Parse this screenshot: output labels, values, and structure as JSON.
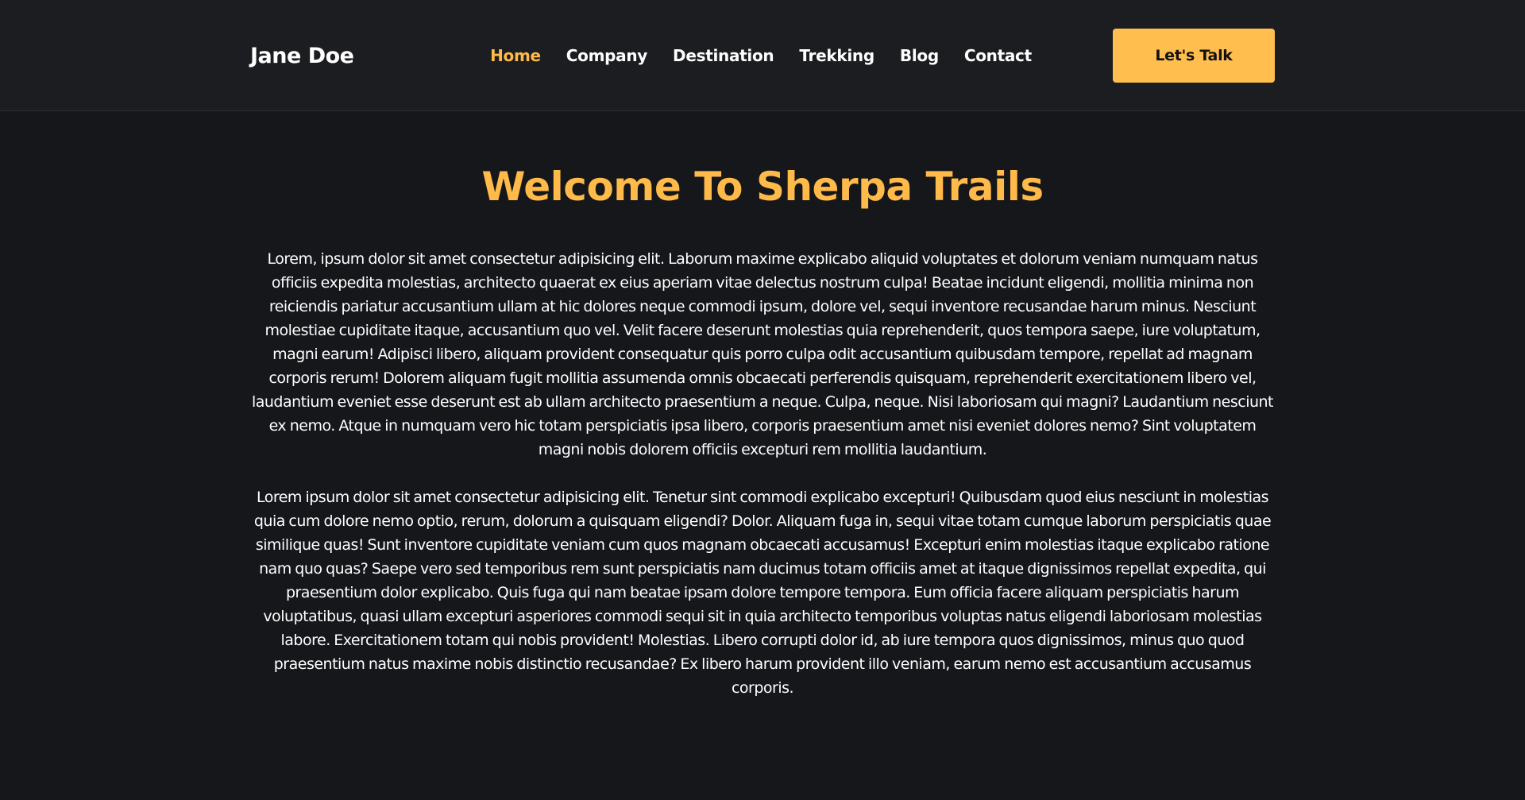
{
  "header": {
    "logo": "Jane Doe",
    "nav": [
      {
        "label": "Home",
        "active": true
      },
      {
        "label": "Company",
        "active": false
      },
      {
        "label": "Destination",
        "active": false
      },
      {
        "label": "Trekking",
        "active": false
      },
      {
        "label": "Blog",
        "active": false
      },
      {
        "label": "Contact",
        "active": false
      }
    ],
    "cta_label": "Let's Talk"
  },
  "main": {
    "title": "Welcome To Sherpa Trails",
    "paragraphs": [
      "Lorem, ipsum dolor sit amet consectetur adipisicing elit. Laborum maxime explicabo aliquid voluptates et dolorum veniam numquam natus officiis expedita molestias, architecto quaerat ex eius aperiam vitae delectus nostrum culpa! Beatae incidunt eligendi, mollitia minima non reiciendis pariatur accusantium ullam at hic dolores neque commodi ipsum, dolore vel, sequi inventore recusandae harum minus. Nesciunt molestiae cupiditate itaque, accusantium quo vel. Velit facere deserunt molestias quia reprehenderit, quos tempora saepe, iure voluptatum, magni earum! Adipisci libero, aliquam provident consequatur quis porro culpa odit accusantium quibusdam tempore, repellat ad magnam corporis rerum! Dolorem aliquam fugit mollitia assumenda omnis obcaecati perferendis quisquam, reprehenderit exercitationem libero vel, laudantium eveniet esse deserunt est ab ullam architecto praesentium a neque. Culpa, neque. Nisi laboriosam qui magni? Laudantium nesciunt ex nemo. Atque in numquam vero hic totam perspiciatis ipsa libero, corporis praesentium amet nisi eveniet dolores nemo? Sint voluptatem magni nobis dolorem officiis excepturi rem mollitia laudantium.",
      "Lorem ipsum dolor sit amet consectetur adipisicing elit. Tenetur sint commodi explicabo excepturi! Quibusdam quod eius nesciunt in molestias quia cum dolore nemo optio, rerum, dolorum a quisquam eligendi? Dolor. Aliquam fuga in, sequi vitae totam cumque laborum perspiciatis quae similique quas! Sunt inventore cupiditate veniam cum quos magnam obcaecati accusamus! Excepturi enim molestias itaque explicabo ratione nam quo quas? Saepe vero sed temporibus rem sunt perspiciatis nam ducimus totam officiis amet at itaque dignissimos repellat expedita, qui praesentium dolor explicabo. Quis fuga qui nam beatae ipsam dolore tempore tempora. Eum officia facere aliquam perspiciatis harum voluptatibus, quasi ullam excepturi asperiores commodi sequi sit in quia architecto temporibus voluptas natus eligendi laboriosam molestias labore. Exercitationem totam qui nobis provident! Molestias. Libero corrupti dolor id, ab iure tempora quos dignissimos, minus quo quod praesentium natus maxime nobis distinctio recusandae? Ex libero harum provident illo veniam, earum nemo est accusantium accusamus corporis."
    ]
  },
  "colors": {
    "accent": "#ffba4a",
    "header_bg": "#1c1d20",
    "page_bg": "#15171a",
    "text": "#ffffff"
  }
}
